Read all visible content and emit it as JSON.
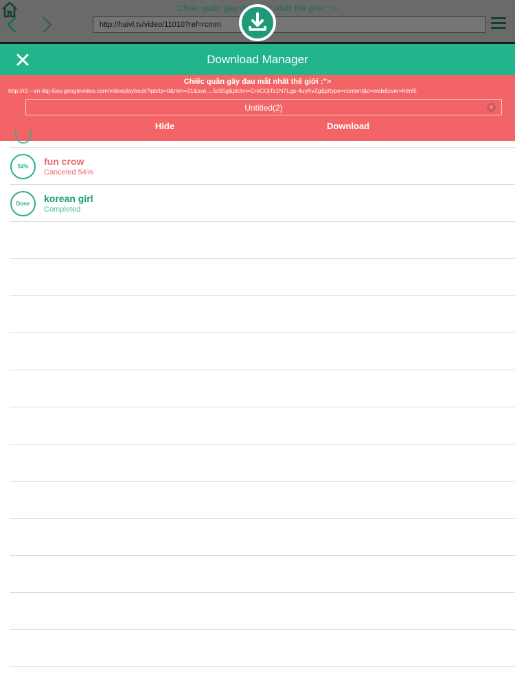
{
  "browser": {
    "page_title": "Chiếc quần gây đau mắt nhất thế giới :\">",
    "url": "http://haivl.tv/video/11010?ref=rcmm"
  },
  "manager": {
    "title": "Download Manager"
  },
  "prompt": {
    "title": "Chiếc quần gây đau mắt nhất thế giới :\">",
    "url": "http://r2---sn-8qj-i5oy.googlevideo.com/videoplayback?ipbits=0&mm=31&sve....5z55g&ptchn=CreCOjTs1N7Lga-4uyKvZg&pltype=content&c=web&cver=html5",
    "filename": "Untitled(2)",
    "hide_label": "Hide",
    "download_label": "Download"
  },
  "downloads": [
    {
      "title": "fun crow",
      "status": "Canceled 54%",
      "progress_label": "54%",
      "state": "canceled"
    },
    {
      "title": "korean girl",
      "status": "Completed",
      "progress_label": "Done",
      "state": "completed"
    }
  ],
  "colors": {
    "accent": "#22b48b",
    "prompt_bg": "#f26466",
    "canceled": "#ec6c6e",
    "completed": "#1f9a78"
  }
}
